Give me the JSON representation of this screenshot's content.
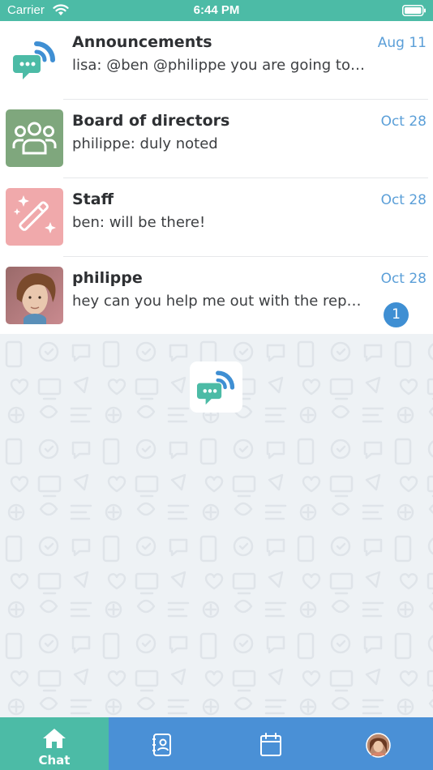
{
  "status_bar": {
    "carrier": "Carrier",
    "time": "6:44 PM"
  },
  "chats": [
    {
      "name": "Announcements",
      "preview": "lisa: @ben @philippe you are going to like this",
      "date": "Aug 11",
      "avatar": "app-logo-icon"
    },
    {
      "name": "Board of directors",
      "preview": "philippe: duly noted",
      "date": "Oct 28",
      "avatar": "group-icon"
    },
    {
      "name": "Staff",
      "preview": "ben: will be there!",
      "date": "Oct 28",
      "avatar": "magic-wand-icon"
    },
    {
      "name": "philippe",
      "preview": "hey can you help me out with the report?",
      "date": "Oct 28",
      "avatar": "user-photo",
      "unread": "1"
    }
  ],
  "tab_bar": {
    "tabs": [
      {
        "label": "Chat",
        "icon": "home-icon",
        "active": true
      },
      {
        "label": "",
        "icon": "contacts-icon"
      },
      {
        "label": "",
        "icon": "calendar-icon"
      },
      {
        "label": "",
        "icon": "profile-avatar"
      }
    ]
  },
  "colors": {
    "brand_green": "#4cbba6",
    "brand_blue": "#4a90d6",
    "date_blue": "#5b9fd8",
    "badge_blue": "#3f8fd3"
  }
}
